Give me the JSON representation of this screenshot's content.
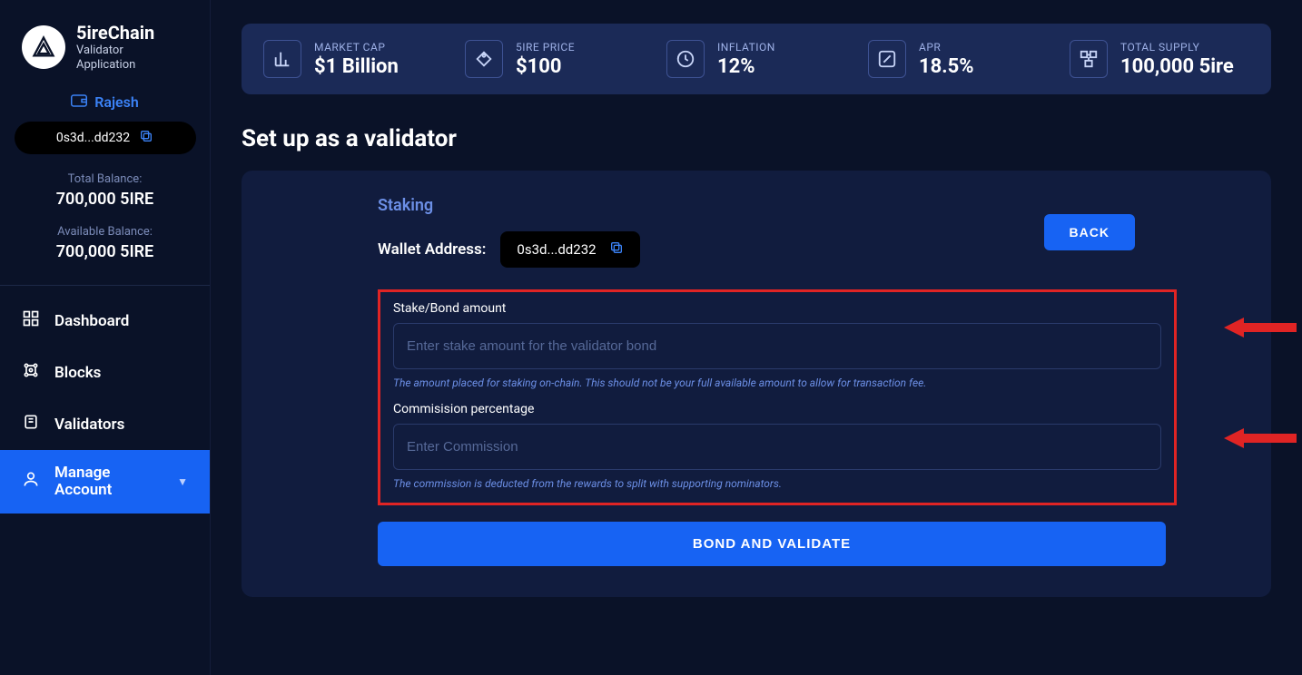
{
  "brand": {
    "title": "5ireChain",
    "subtitle_l1": "Validator",
    "subtitle_l2": "Application"
  },
  "user": {
    "name": "Rajesh",
    "address": "0s3d...dd232"
  },
  "balances": {
    "total_label": "Total Balance:",
    "total_value": "700,000 5IRE",
    "avail_label": "Available Balance:",
    "avail_value": "700,000 5IRE"
  },
  "nav": {
    "dashboard": "Dashboard",
    "blocks": "Blocks",
    "validators": "Validators",
    "manage_l1": "Manage",
    "manage_l2": "Account"
  },
  "stats": {
    "marketcap_label": "MARKET CAP",
    "marketcap_value": "$1 Billion",
    "price_label": "5IRE PRICE",
    "price_value": "$100",
    "inflation_label": "INFLATION",
    "inflation_value": "12%",
    "apr_label": "APR",
    "apr_value": "18.5%",
    "supply_label": "TOTAL SUPPLY",
    "supply_value": "100,000 5ire"
  },
  "page": {
    "title": "Set up as a validator"
  },
  "staking": {
    "heading": "Staking",
    "wallet_label": "Wallet Address:",
    "wallet_addr": "0s3d...dd232",
    "back_label": "BACK",
    "stake_label": "Stake/Bond amount",
    "stake_placeholder": "Enter stake amount for the validator bond",
    "stake_help": "The amount placed for staking on-chain. This should not be your full available amount to allow for transaction fee.",
    "comm_label": "Commisision percentage",
    "comm_placeholder": "Enter Commission",
    "comm_help": "The commission is deducted from the rewards to split with supporting nominators.",
    "bond_label": "BOND AND VALIDATE"
  }
}
